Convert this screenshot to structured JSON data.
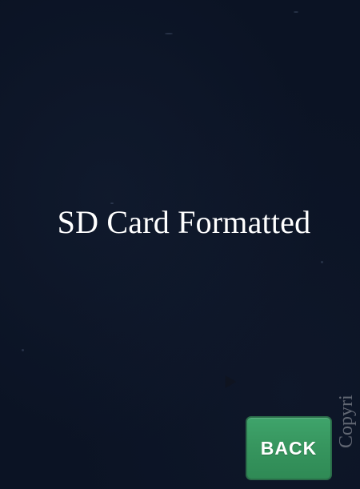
{
  "dialog": {
    "message": "SD Card Formatted"
  },
  "controls": {
    "back_label": "BACK"
  },
  "watermark": {
    "text": "Copyri"
  },
  "colors": {
    "background": "#0b1324",
    "button": "#37965f",
    "text": "#ffffff"
  }
}
